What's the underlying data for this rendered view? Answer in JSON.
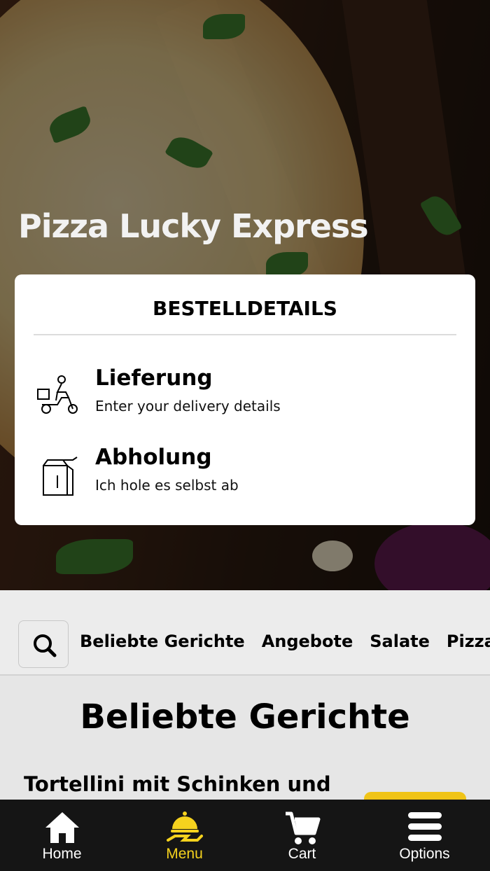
{
  "hero": {
    "title": "Pizza Lucky Express"
  },
  "order_card": {
    "title": "BESTELLDETAILS",
    "options": [
      {
        "title": "Lieferung",
        "subtitle": "Enter your delivery details",
        "icon": "delivery-scooter-icon"
      },
      {
        "title": "Abholung",
        "subtitle": "Ich hole es selbst ab",
        "icon": "takeaway-bag-icon"
      }
    ]
  },
  "categories": {
    "search_icon": "search-icon",
    "items": [
      "Beliebte Gerichte",
      "Angebote",
      "Salate",
      "Pizza"
    ]
  },
  "section": {
    "title": "Beliebte Gerichte",
    "first_dish": "Tortellini mit Schinken und"
  },
  "bottom_nav": {
    "items": [
      {
        "label": "Home",
        "icon": "home-icon",
        "active": false
      },
      {
        "label": "Menu",
        "icon": "menu-cloche-icon",
        "active": true
      },
      {
        "label": "Cart",
        "icon": "cart-icon",
        "active": false
      },
      {
        "label": "Options",
        "icon": "hamburger-icon",
        "active": false
      }
    ]
  },
  "colors": {
    "accent": "#f5d21e",
    "nav_background": "#151515",
    "card_background": "#ffffff"
  }
}
